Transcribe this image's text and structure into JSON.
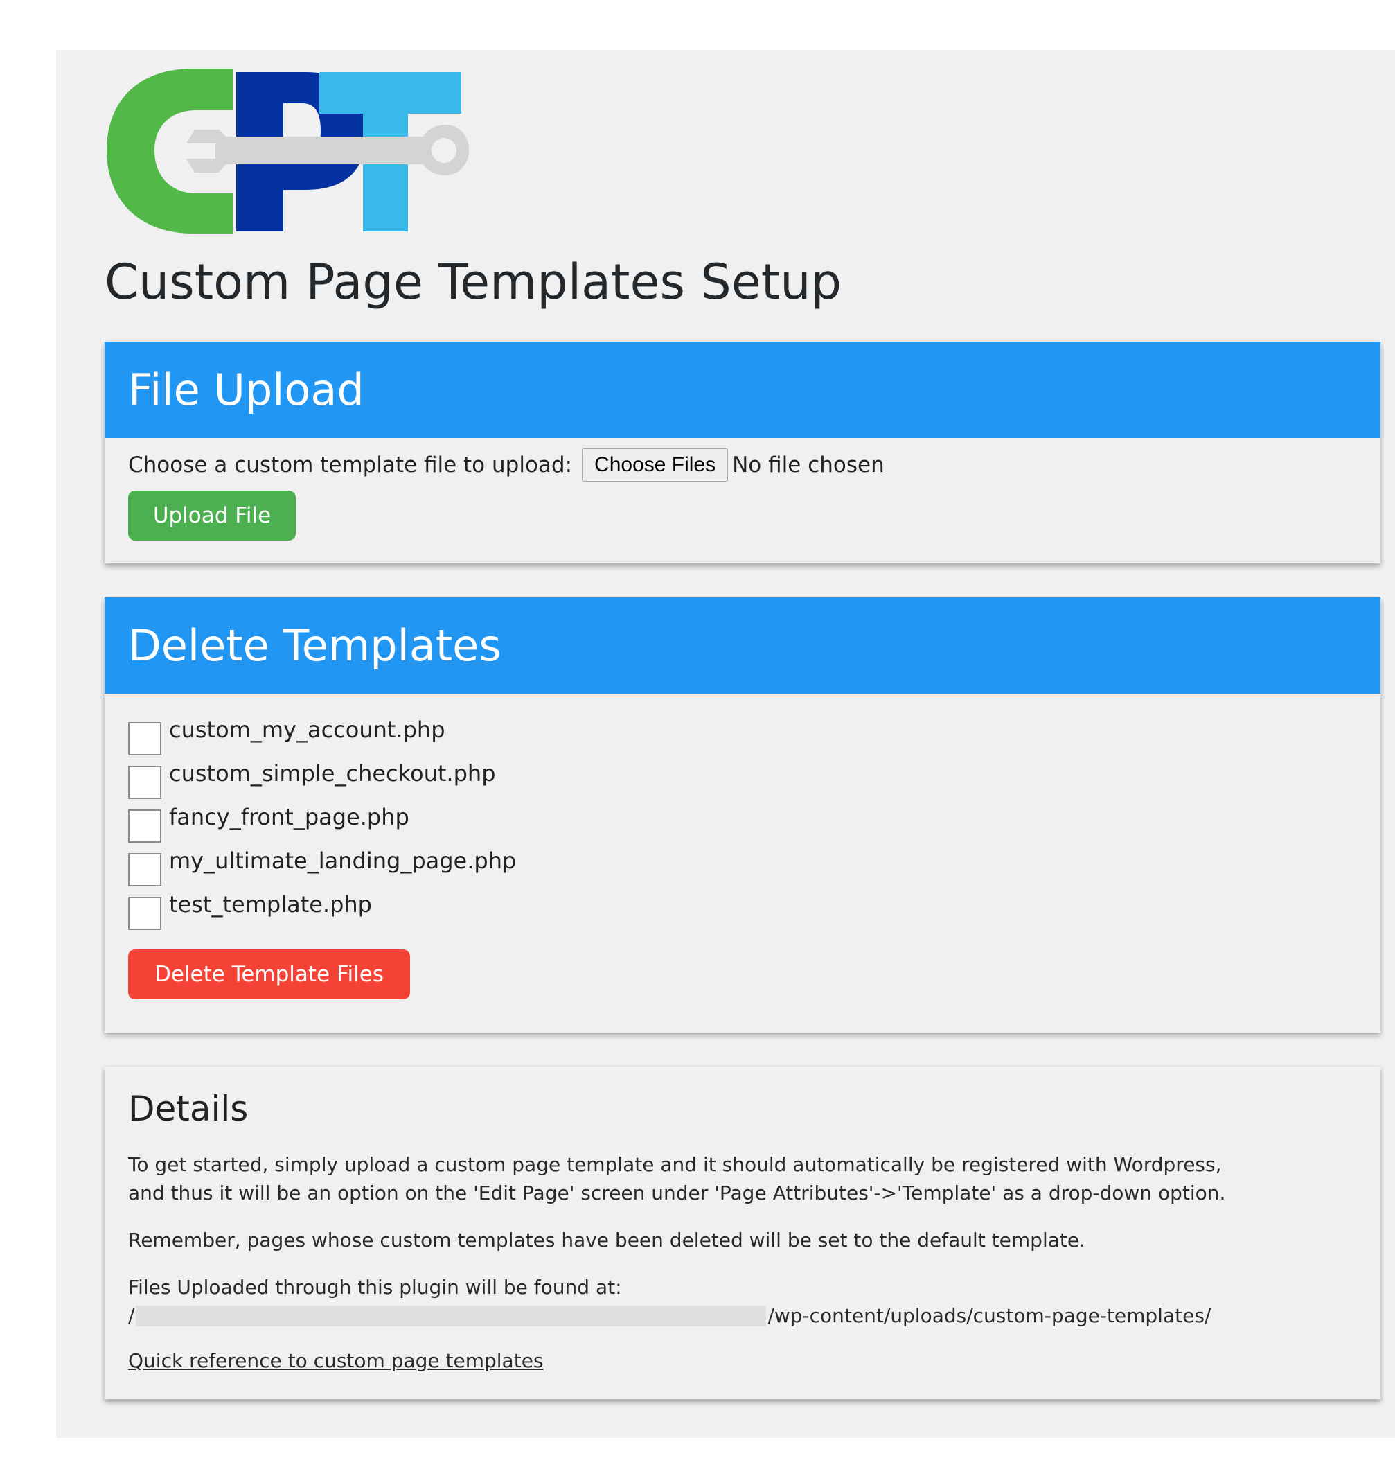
{
  "logo": {
    "text": "CPT",
    "colors": {
      "c": "#52b848",
      "p": "#0432a0",
      "t": "#3ab8ea",
      "wrench": "#d4d4d4"
    },
    "icon": "wrench-icon"
  },
  "page_title": "Custom Page Templates Setup",
  "upload_card": {
    "title": "File Upload",
    "prompt": "Choose a custom template file to upload:",
    "choose_button": "Choose Files",
    "file_status": "No file chosen",
    "upload_button": "Upload File"
  },
  "delete_card": {
    "title": "Delete Templates",
    "templates": [
      {
        "name": "custom_my_account.php",
        "checked": false
      },
      {
        "name": "custom_simple_checkout.php",
        "checked": false
      },
      {
        "name": "fancy_front_page.php",
        "checked": false
      },
      {
        "name": "my_ultimate_landing_page.php",
        "checked": false
      },
      {
        "name": "test_template.php",
        "checked": false
      }
    ],
    "delete_button": "Delete Template Files"
  },
  "details_card": {
    "title": "Details",
    "paragraph1_line1": "To get started, simply upload a custom page template and it should automatically be registered with Wordpress,",
    "paragraph1_line2": "and thus it will be an option on the 'Edit Page' screen under 'Page Attributes'->'Template' as a drop-down option.",
    "paragraph2": "Remember, pages whose custom templates have been deleted will be set to the default template.",
    "paragraph3": "Files Uploaded through this plugin will be found at:",
    "path_prefix": "/",
    "path_suffix": "/wp-content/uploads/custom-page-templates/",
    "link_text": "Quick reference to custom page templates"
  },
  "colors": {
    "header_blue": "#2196f3",
    "upload_green": "#4caf50",
    "delete_red": "#f44336",
    "panel_bg": "#f0f0f0"
  }
}
